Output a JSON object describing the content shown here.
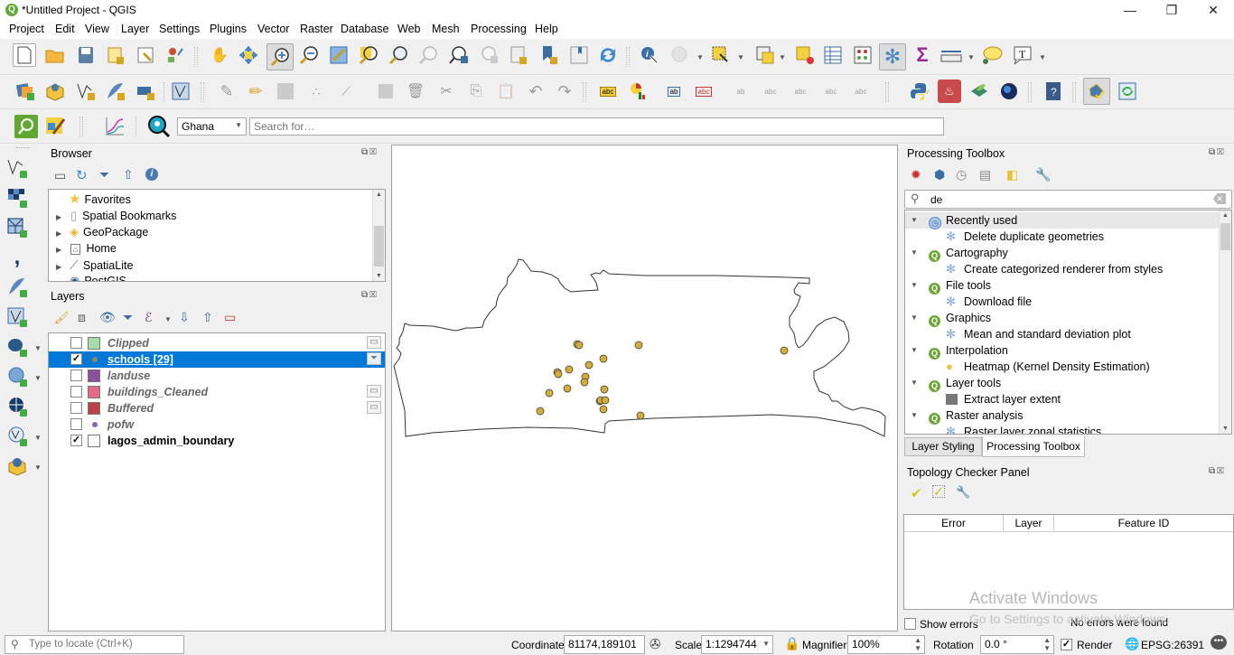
{
  "window": {
    "title": "*Untitled Project - QGIS",
    "minimize": "—",
    "restore": "❐",
    "close": "✕"
  },
  "menu": [
    "Project",
    "Edit",
    "View",
    "Layer",
    "Settings",
    "Plugins",
    "Vector",
    "Raster",
    "Database",
    "Web",
    "Mesh",
    "Processing",
    "Help"
  ],
  "toolbar3": {
    "locator_combo": "Ghana",
    "search_placeholder": "Search for…"
  },
  "browser": {
    "title": "Browser",
    "items": [
      {
        "label": "Favorites",
        "icon": "star-icon",
        "expandable": false
      },
      {
        "label": "Spatial Bookmarks",
        "icon": "bookmark-icon",
        "expandable": true
      },
      {
        "label": "GeoPackage",
        "icon": "geopackage-icon",
        "expandable": true
      },
      {
        "label": "Home",
        "icon": "home-folder-icon",
        "expandable": true
      },
      {
        "label": "SpatiaLite",
        "icon": "feather-icon",
        "expandable": true
      },
      {
        "label": "PostGIS",
        "icon": "elephant-icon",
        "expandable": false
      }
    ]
  },
  "layers": {
    "title": "Layers",
    "items": [
      {
        "name": "Clipped",
        "checked": false,
        "swatch": "#a8dca8",
        "type": "polygon",
        "indicator": "memory-layer-icon"
      },
      {
        "name": "schools [29]",
        "checked": true,
        "swatch": "#8a8a5a",
        "type": "point",
        "selected": true,
        "indicator": "filter-icon"
      },
      {
        "name": "landuse",
        "checked": false,
        "swatch": "#8a4f9a",
        "type": "polygon"
      },
      {
        "name": "buildings_Cleaned",
        "checked": false,
        "swatch": "#e36a87",
        "type": "polygon",
        "indicator": "memory-layer-icon"
      },
      {
        "name": "Buffered",
        "checked": false,
        "swatch": "#b84446",
        "type": "polygon",
        "indicator": "memory-layer-icon"
      },
      {
        "name": "pofw",
        "checked": false,
        "swatch": "#8a66b0",
        "type": "point"
      },
      {
        "name": "lagos_admin_boundary",
        "checked": true,
        "swatch": "#ffffff",
        "type": "polygon"
      }
    ]
  },
  "map": {
    "point_color": "#d4ad3c",
    "boundary_color": "#333333"
  },
  "processing": {
    "title": "Processing Toolbox",
    "search_value": "de",
    "groups": [
      {
        "label": "Recently used",
        "icon": "clock-icon",
        "algorithm": "Delete duplicate geometries",
        "alg_icon": "gear-icon"
      },
      {
        "label": "Cartography",
        "icon": "qgis-icon",
        "algorithm": "Create categorized renderer from styles",
        "alg_icon": "gear-icon"
      },
      {
        "label": "File tools",
        "icon": "qgis-icon",
        "algorithm": "Download file",
        "alg_icon": "gear-icon"
      },
      {
        "label": "Graphics",
        "icon": "qgis-icon",
        "algorithm": "Mean and standard deviation plot",
        "alg_icon": "gear-icon"
      },
      {
        "label": "Interpolation",
        "icon": "qgis-icon",
        "algorithm": "Heatmap (Kernel Density Estimation)",
        "alg_icon": "heatmap-icon"
      },
      {
        "label": "Layer tools",
        "icon": "qgis-icon",
        "algorithm": "Extract layer extent",
        "alg_icon": "extent-icon"
      },
      {
        "label": "Raster analysis",
        "icon": "qgis-icon",
        "algorithm": "Raster layer zonal statistics",
        "alg_icon": "gear-icon"
      }
    ],
    "tabs": [
      "Layer Styling",
      "Processing Toolbox"
    ]
  },
  "topology": {
    "title": "Topology Checker Panel",
    "columns": [
      "Error",
      "Layer",
      "Feature ID"
    ],
    "show_errors_label": "Show errors",
    "show_errors_checked": false,
    "status": "No errors were found"
  },
  "watermark": {
    "line1": "Activate Windows",
    "line2": "Go to Settings to activate Windows."
  },
  "statusbar": {
    "locator_placeholder": "Type to locate (Ctrl+K)",
    "coordinate_label": "Coordinate",
    "coordinate_value": "81174,189101",
    "scale_label": "Scale",
    "scale_value": "1:1294744",
    "magnifier_label": "Magnifier",
    "magnifier_value": "100%",
    "rotation_label": "Rotation",
    "rotation_value": "0.0 °",
    "render_label": "Render",
    "render_checked": true,
    "crs": "EPSG:26391"
  }
}
